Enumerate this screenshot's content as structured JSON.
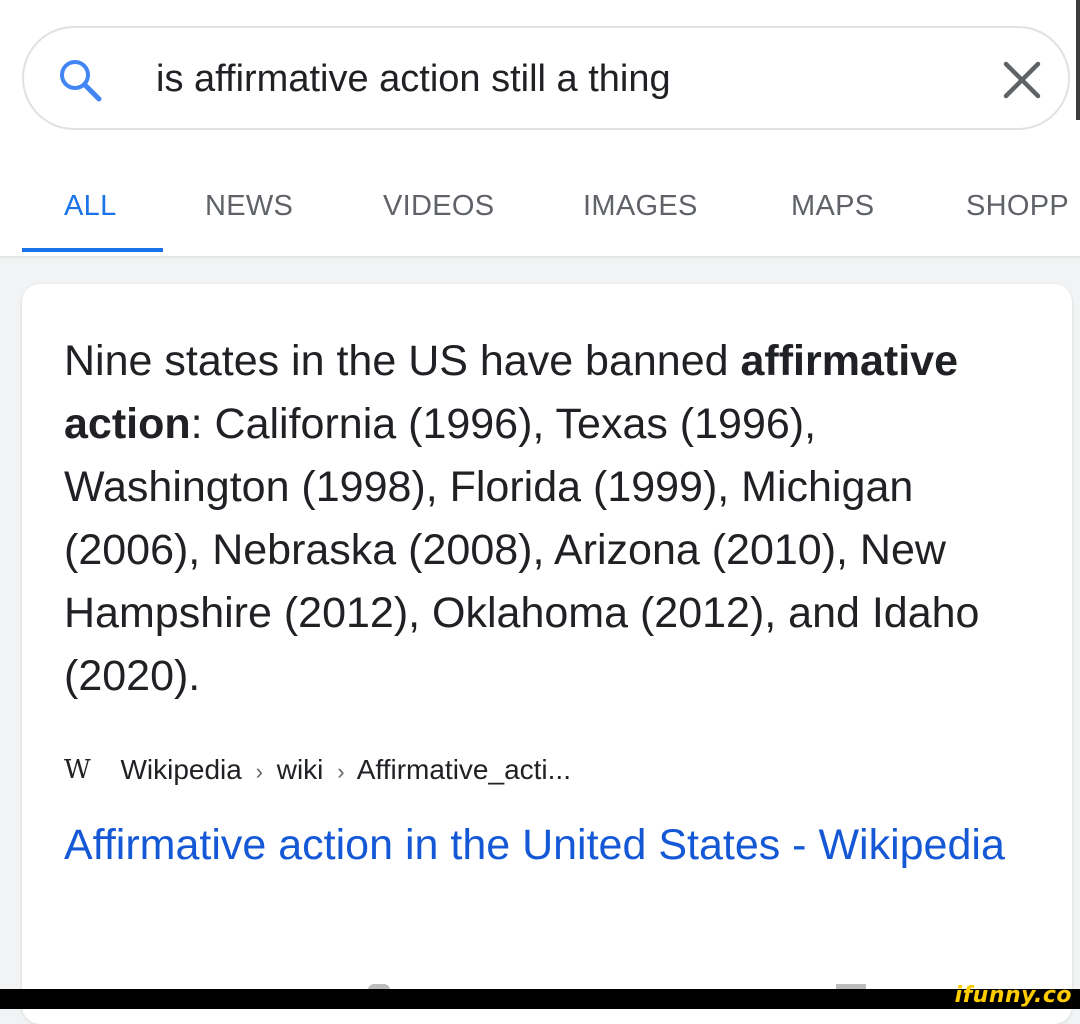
{
  "search": {
    "query": "is affirmative action still a thing",
    "search_icon": "search-icon",
    "clear_icon": "close-icon"
  },
  "tabs": [
    {
      "label": "ALL",
      "active": true
    },
    {
      "label": "NEWS"
    },
    {
      "label": "VIDEOS"
    },
    {
      "label": "IMAGES"
    },
    {
      "label": "MAPS"
    },
    {
      "label": "SHOPP"
    }
  ],
  "result": {
    "snippet_before": "Nine states in the US have banned ",
    "snippet_bold": "affirmative action",
    "snippet_after": ": California (1996), Texas (1996), Washington (1998), Florida (1999), Michigan (2006), Nebraska (2008), Arizona (2010), New Hampshire (2012), Oklahoma (2012), and Idaho (2020).",
    "source_logo": "W",
    "breadcrumb": [
      "Wikipedia",
      "wiki",
      "Affirmative_acti..."
    ],
    "breadcrumb_separator": "›",
    "title": "Affirmative action in the United States - Wikipedia"
  },
  "watermark": "ifunny.co",
  "colors": {
    "accent": "#1a73e8",
    "link": "#1558d6",
    "text": "#202124",
    "muted": "#5f6368"
  }
}
